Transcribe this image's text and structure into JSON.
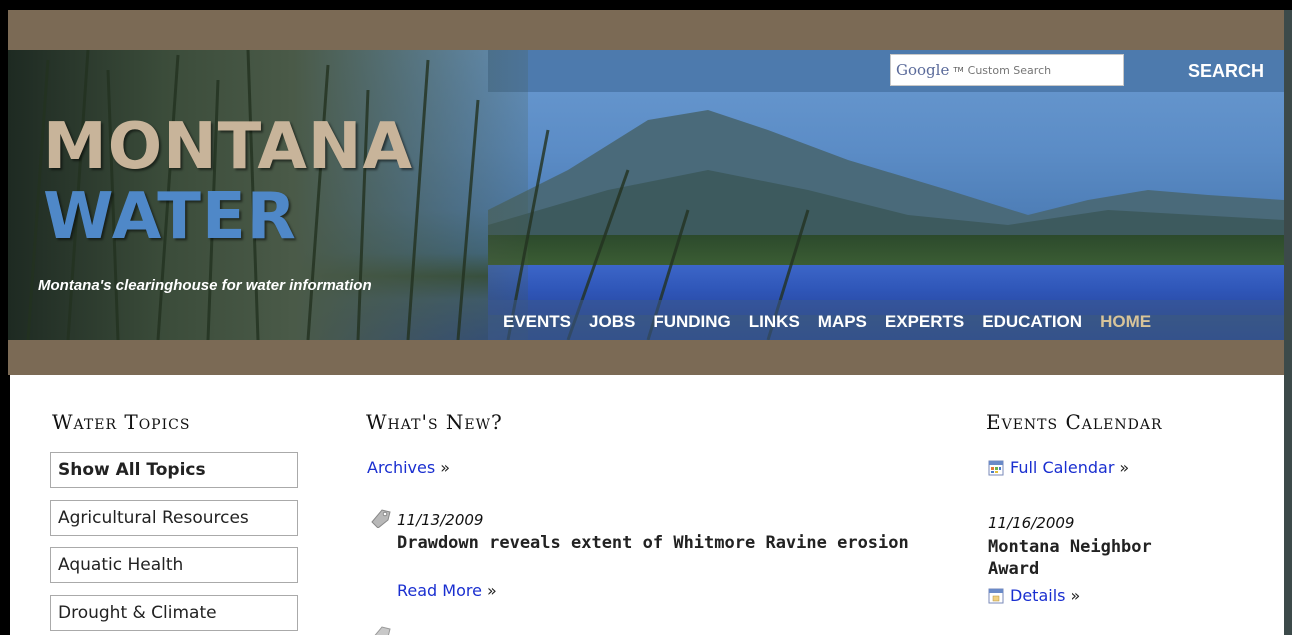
{
  "header": {
    "title_line1": "MONTANA",
    "title_line2": "WATER",
    "tagline": "Montana's clearinghouse for water information",
    "search": {
      "logo_text": "Google",
      "logo_tm": "TM",
      "placeholder": "Custom Search",
      "button_label": "SEARCH"
    },
    "nav": [
      {
        "label": "EVENTS",
        "active": false
      },
      {
        "label": "JOBS",
        "active": false
      },
      {
        "label": "FUNDING",
        "active": false
      },
      {
        "label": "LINKS",
        "active": false
      },
      {
        "label": "MAPS",
        "active": false
      },
      {
        "label": "EXPERTS",
        "active": false
      },
      {
        "label": "EDUCATION",
        "active": false
      },
      {
        "label": "HOME",
        "active": true
      }
    ]
  },
  "topics": {
    "heading": "Water Topics",
    "items": [
      {
        "label": "Show All Topics",
        "bold": true
      },
      {
        "label": "Agricultural Resources",
        "bold": false
      },
      {
        "label": "Aquatic Health",
        "bold": false
      },
      {
        "label": "Drought & Climate",
        "bold": false
      }
    ]
  },
  "news": {
    "heading": "What's New?",
    "archives_label": "Archives",
    "arrow": "»",
    "items": [
      {
        "date": "11/13/2009",
        "title": "Drawdown reveals extent of Whitmore Ravine erosion",
        "read_more": "Read More"
      }
    ]
  },
  "events": {
    "heading": "Events Calendar",
    "full_calendar_label": "Full Calendar",
    "arrow": "»",
    "items": [
      {
        "date": "11/16/2009",
        "title": "Montana Neighbor Award",
        "details_label": "Details"
      }
    ]
  },
  "colors": {
    "brown_band": "#7b6a55",
    "link_blue": "#1a2fd0",
    "title_tan": "#c8b49a",
    "title_blue": "#4f88c8",
    "nav_active": "#d8c49a"
  }
}
